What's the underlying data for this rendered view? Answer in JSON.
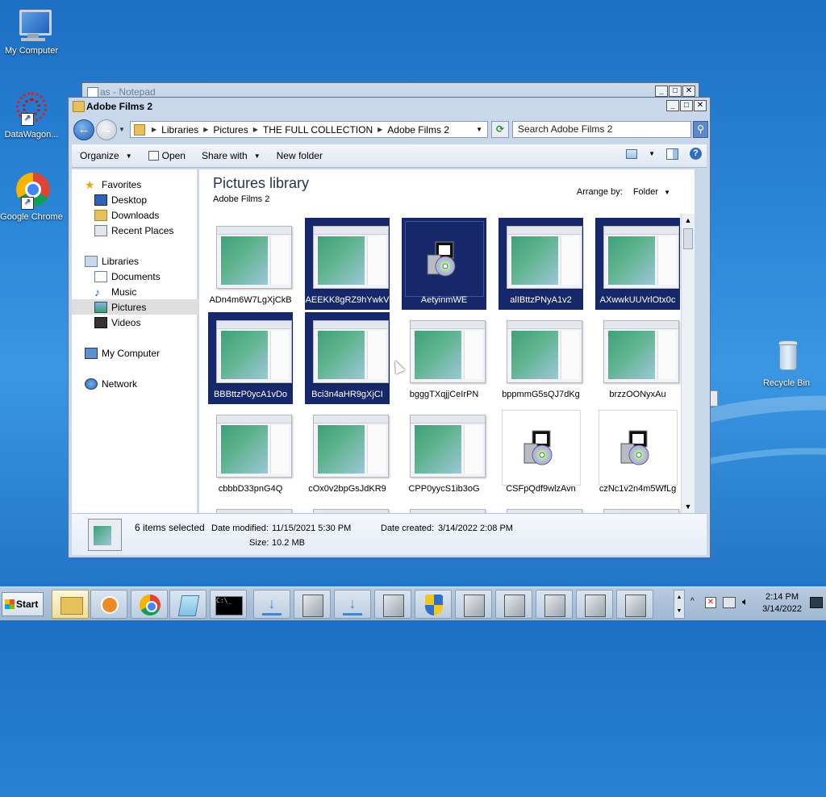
{
  "desktop": {
    "icons": [
      {
        "label": "My Computer"
      },
      {
        "label": "DataWagon..."
      },
      {
        "label": "Google Chrome"
      },
      {
        "label": "Recycle Bin"
      }
    ]
  },
  "notepad": {
    "title": "as - Notepad"
  },
  "explorer": {
    "title": "Adobe Films 2",
    "caption": {
      "minimize": "_",
      "maximize": "□",
      "close": "✕"
    },
    "breadcrumb": [
      "Libraries",
      "Pictures",
      "THE FULL COLLECTION",
      "Adobe Films 2"
    ],
    "search_placeholder": "Search Adobe Films 2",
    "toolbar": {
      "organize": "Organize",
      "open": "Open",
      "share": "Share with",
      "new_folder": "New folder"
    },
    "nav": {
      "favorites": "Favorites",
      "desktop": "Desktop",
      "downloads": "Downloads",
      "recent": "Recent Places",
      "libraries": "Libraries",
      "documents": "Documents",
      "music": "Music",
      "pictures": "Pictures",
      "videos": "Videos",
      "computer": "My Computer",
      "network": "Network"
    },
    "library_title": "Pictures library",
    "library_sub": "Adobe Films 2",
    "arrange_label": "Arrange by:",
    "arrange_value": "Folder",
    "items": [
      {
        "name": "ADn4m6W7LgXjCkB",
        "type": "image",
        "selected": false
      },
      {
        "name": "AEEKK8gRZ9hYwkV",
        "type": "image",
        "selected": true
      },
      {
        "name": "AetyinmWE",
        "type": "installer",
        "selected": true
      },
      {
        "name": "alIBttzPNyA1v2",
        "type": "image",
        "selected": true
      },
      {
        "name": "AXwwkUUVrlOtx0c",
        "type": "image",
        "selected": true
      },
      {
        "name": "BBBttzP0ycA1vDo",
        "type": "image",
        "selected": true
      },
      {
        "name": "Bci3n4aHR9gXjCI",
        "type": "image",
        "selected": true
      },
      {
        "name": "bgggTXqjjCeIrPN",
        "type": "image",
        "selected": false
      },
      {
        "name": "bppmmG5sQJ7dKg",
        "type": "image",
        "selected": false
      },
      {
        "name": "brzzOONyxAu",
        "type": "image",
        "selected": false
      },
      {
        "name": "cbbbD33pnG4Q",
        "type": "image",
        "selected": false
      },
      {
        "name": "cOx0v2bpGsJdKR9",
        "type": "image",
        "selected": false
      },
      {
        "name": "CPP0yycS1ib3oG",
        "type": "image",
        "selected": false
      },
      {
        "name": "CSFpQdf9wlzAvn",
        "type": "installer",
        "selected": false
      },
      {
        "name": "czNc1v2n4m5WfLg",
        "type": "installer",
        "selected": false
      }
    ],
    "details": {
      "count": "6 items selected",
      "modified_label": "Date modified:",
      "modified_value": "11/15/2021 5:30 PM",
      "created_label": "Date created:",
      "created_value": "3/14/2022 2:08 PM",
      "size_label": "Size:",
      "size_value": "10.2 MB"
    }
  },
  "taskbar": {
    "start": "Start",
    "time": "2:14 PM",
    "date": "3/14/2022"
  }
}
